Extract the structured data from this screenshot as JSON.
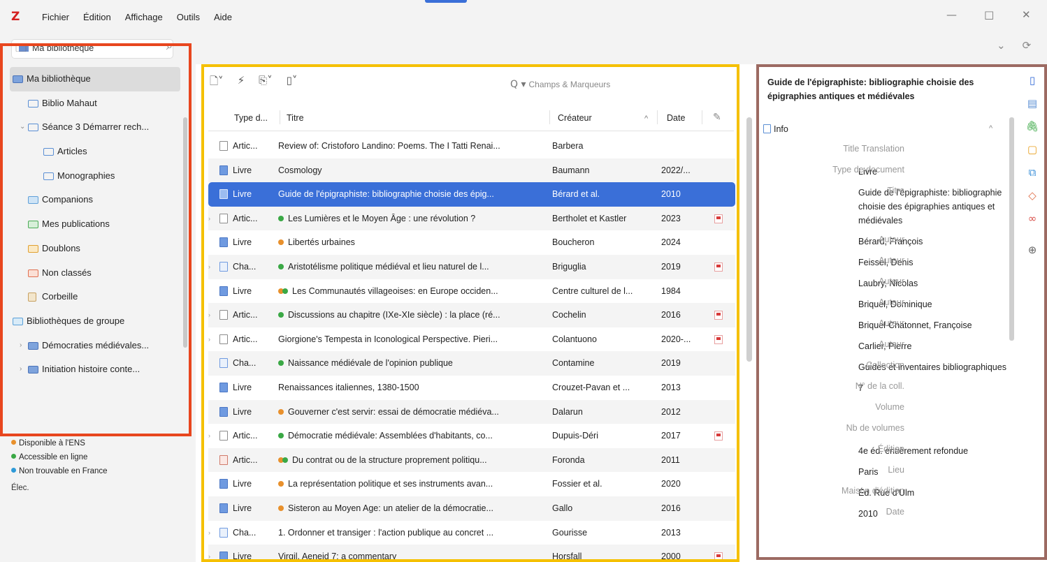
{
  "app": {
    "logo": "Z"
  },
  "menu": [
    "Fichier",
    "Édition",
    "Affichage",
    "Outils",
    "Aide"
  ],
  "window_controls": {
    "minimize": "—",
    "maximize": "□",
    "close": "✕"
  },
  "library_selector": "Ma bibliothèque",
  "collections": [
    {
      "label": "Ma bibliothèque",
      "level": 0,
      "twisty": "⌄",
      "icon": "library-icon",
      "selected": true
    },
    {
      "label": "Biblio Mahaut",
      "level": 1,
      "twisty": "",
      "icon": "folder-icon"
    },
    {
      "label": "Séance 3 Démarrer rech...",
      "level": 1,
      "twisty": "⌄",
      "icon": "folder-icon"
    },
    {
      "label": "Articles",
      "level": 2,
      "twisty": "",
      "icon": "folder-icon"
    },
    {
      "label": "Monographies",
      "level": 2,
      "twisty": "",
      "icon": "folder-icon"
    },
    {
      "label": "Companions",
      "level": 1,
      "twisty": "",
      "icon": "companions-icon"
    },
    {
      "label": "Mes publications",
      "level": 1,
      "twisty": "",
      "icon": "publications-icon"
    },
    {
      "label": "Doublons",
      "level": 1,
      "twisty": "",
      "icon": "duplicates-icon"
    },
    {
      "label": "Non classés",
      "level": 1,
      "twisty": "",
      "icon": "unfiled-icon"
    },
    {
      "label": "Corbeille",
      "level": 1,
      "twisty": "",
      "icon": "trash-icon"
    },
    {
      "label": "Bibliothèques de groupe",
      "level": 0,
      "twisty": "",
      "icon": "group-icon"
    },
    {
      "label": "Démocraties médiévales...",
      "level": 1,
      "twisty": "›",
      "icon": "library-icon"
    },
    {
      "label": "Initiation histoire conte...",
      "level": 1,
      "twisty": "›",
      "icon": "library-icon"
    }
  ],
  "tags": [
    {
      "label": "Disponible à l'ENS",
      "color": "#e8902c"
    },
    {
      "label": "Accessible en ligne",
      "color": "#3aa845"
    },
    {
      "label": "Non trouvable en France",
      "color": "#2e9ad8"
    }
  ],
  "tag_extra": "Élec.",
  "search": {
    "mode": "Q ▾",
    "placeholder": "Champs & Marqueurs"
  },
  "columns": {
    "type": "Type d...",
    "title": "Titre",
    "creator": "Créateur",
    "sort": "^",
    "date": "Date"
  },
  "items": [
    {
      "twisty": "",
      "icon": "article",
      "type": "Artic...",
      "dots": [],
      "title": "Review of: Cristoforo Landino: Poems. The I Tatti Renai...",
      "creator": "Barbera",
      "date": "",
      "pdf": false
    },
    {
      "twisty": "",
      "icon": "book",
      "type": "Livre",
      "dots": [],
      "title": "Cosmology",
      "creator": "Baumann",
      "date": "2022/...",
      "pdf": false
    },
    {
      "twisty": "",
      "icon": "book",
      "type": "Livre",
      "dots": [],
      "title": "Guide de l'épigraphiste: bibliographie choisie des épig...",
      "creator": "Bérard et al.",
      "date": "2010",
      "pdf": false,
      "selected": true
    },
    {
      "twisty": "›",
      "icon": "article",
      "type": "Artic...",
      "dots": [
        "#3aa845"
      ],
      "title": "Les Lumières et le Moyen Âge : une révolution ?",
      "creator": "Bertholet et Kastler",
      "date": "2023",
      "pdf": true
    },
    {
      "twisty": "",
      "icon": "book",
      "type": "Livre",
      "dots": [
        "#e8902c"
      ],
      "title": "Libertés urbaines",
      "creator": "Boucheron",
      "date": "2024",
      "pdf": false
    },
    {
      "twisty": "›",
      "icon": "chapter",
      "type": "Cha...",
      "dots": [
        "#3aa845"
      ],
      "title": "Aristotélisme politique médiéval et lieu naturel de l...",
      "creator": "Briguglia",
      "date": "2019",
      "pdf": true
    },
    {
      "twisty": "",
      "icon": "book",
      "type": "Livre",
      "dots": [
        "#e8902c",
        "#3aa845"
      ],
      "title": "Les Communautés villageoises: en Europe occiden...",
      "creator": "Centre culturel de l...",
      "date": "1984",
      "pdf": false
    },
    {
      "twisty": "›",
      "icon": "article",
      "type": "Artic...",
      "dots": [
        "#3aa845"
      ],
      "title": "Discussions au chapitre (IXe-XIe siècle) : la place (ré...",
      "creator": "Cochelin",
      "date": "2016",
      "pdf": true
    },
    {
      "twisty": "›",
      "icon": "article",
      "type": "Artic...",
      "dots": [],
      "title": "Giorgione's Tempesta in Iconological Perspective. Pieri...",
      "creator": "Colantuono",
      "date": "2020-...",
      "pdf": true
    },
    {
      "twisty": "",
      "icon": "chapter",
      "type": "Cha...",
      "dots": [
        "#3aa845"
      ],
      "title": "Naissance médiévale de l'opinion publique",
      "creator": "Contamine",
      "date": "2019",
      "pdf": false
    },
    {
      "twisty": "",
      "icon": "book",
      "type": "Livre",
      "dots": [],
      "title": "Renaissances italiennes, 1380-1500",
      "creator": "Crouzet-Pavan et ...",
      "date": "2013",
      "pdf": false
    },
    {
      "twisty": "",
      "icon": "book",
      "type": "Livre",
      "dots": [
        "#e8902c"
      ],
      "title": "Gouverner c'est servir: essai de démocratie médiéva...",
      "creator": "Dalarun",
      "date": "2012",
      "pdf": false
    },
    {
      "twisty": "›",
      "icon": "article",
      "type": "Artic...",
      "dots": [
        "#3aa845"
      ],
      "title": "Démocratie médiévale: Assemblées d'habitants, co...",
      "creator": "Dupuis-Déri",
      "date": "2017",
      "pdf": true
    },
    {
      "twisty": "",
      "icon": "other",
      "type": "Artic...",
      "dots": [
        "#e8902c",
        "#3aa845"
      ],
      "title": "Du contrat ou de la structure proprement politiqu...",
      "creator": "Foronda",
      "date": "2011",
      "pdf": false
    },
    {
      "twisty": "",
      "icon": "book",
      "type": "Livre",
      "dots": [
        "#e8902c"
      ],
      "title": "La représentation politique et ses instruments avan...",
      "creator": "Fossier et al.",
      "date": "2020",
      "pdf": false
    },
    {
      "twisty": "",
      "icon": "book",
      "type": "Livre",
      "dots": [
        "#e8902c"
      ],
      "title": "Sisteron au Moyen Age: un atelier de la démocratie...",
      "creator": "Gallo",
      "date": "2016",
      "pdf": false
    },
    {
      "twisty": "›",
      "icon": "chapter",
      "type": "Cha...",
      "dots": [],
      "title": "1. Ordonner et transiger : l'action publique au concret ...",
      "creator": "Gourisse",
      "date": "2013",
      "pdf": false
    },
    {
      "twisty": "›",
      "icon": "book",
      "type": "Livre",
      "dots": [],
      "title": "Virgil, Aeneid 7: a commentary",
      "creator": "Horsfall",
      "date": "2000",
      "pdf": true
    }
  ],
  "item_pane": {
    "header": "Guide de l'épigraphiste: bibliographie choisie des épigraphies antiques et médiévales",
    "section": "Info",
    "section_toggle": "^",
    "fields": [
      {
        "label": "Title Translation",
        "value": ""
      },
      {
        "label": "Type de document",
        "value": "Livre"
      },
      {
        "label": "Titre",
        "value": "Guide de l'épigraphiste: bibliographie choisie des épigraphies antiques et médiévales"
      },
      {
        "label": "Auteur",
        "value": "Bérard, François"
      },
      {
        "label": "Auteur",
        "value": "Feissel, Denis"
      },
      {
        "label": "Auteur",
        "value": "Laubry, Nicolas"
      },
      {
        "label": "Auteur",
        "value": "Briquel, Dominique"
      },
      {
        "label": "Auteur",
        "value": "Briquel-Chatonnet, Françoise"
      },
      {
        "label": "Auteur",
        "value": "Carlier, Pierre"
      },
      {
        "label": "Collection",
        "value": "Guides et inventaires bibliographiques"
      },
      {
        "label": "N° de la coll.",
        "value": "7"
      },
      {
        "label": "Volume",
        "value": ""
      },
      {
        "label": "Nb de volumes",
        "value": ""
      },
      {
        "label": "Édition",
        "value": "4e éd. entièrement refondue"
      },
      {
        "label": "Lieu",
        "value": "Paris"
      },
      {
        "label": "Maison d'édition",
        "value": "Éd. Rue d'Ulm"
      },
      {
        "label": "Date",
        "value": "2010"
      }
    ]
  },
  "side_nav": [
    {
      "icon": "info-section-icon",
      "glyph": "▯",
      "color": "#3a6fd8"
    },
    {
      "icon": "abstract-section-icon",
      "glyph": "▤",
      "color": "#5b8fd4"
    },
    {
      "icon": "attachments-section-icon",
      "glyph": "🖇",
      "color": "#3aa845"
    },
    {
      "icon": "notes-section-icon",
      "glyph": "▢",
      "color": "#e8a020"
    },
    {
      "icon": "libraries-collections-section-icon",
      "glyph": "⧉",
      "color": "#3a8fd8"
    },
    {
      "icon": "tags-section-icon",
      "glyph": "◇",
      "color": "#e0704a"
    },
    {
      "icon": "related-section-icon",
      "glyph": "∞",
      "color": "#d8504a"
    },
    {
      "icon": "locate-icon",
      "glyph": "⊕",
      "color": "#666"
    }
  ],
  "highlights": {
    "left": "#e8461e",
    "middle": "#f5c000",
    "right": "#9c6a62"
  }
}
